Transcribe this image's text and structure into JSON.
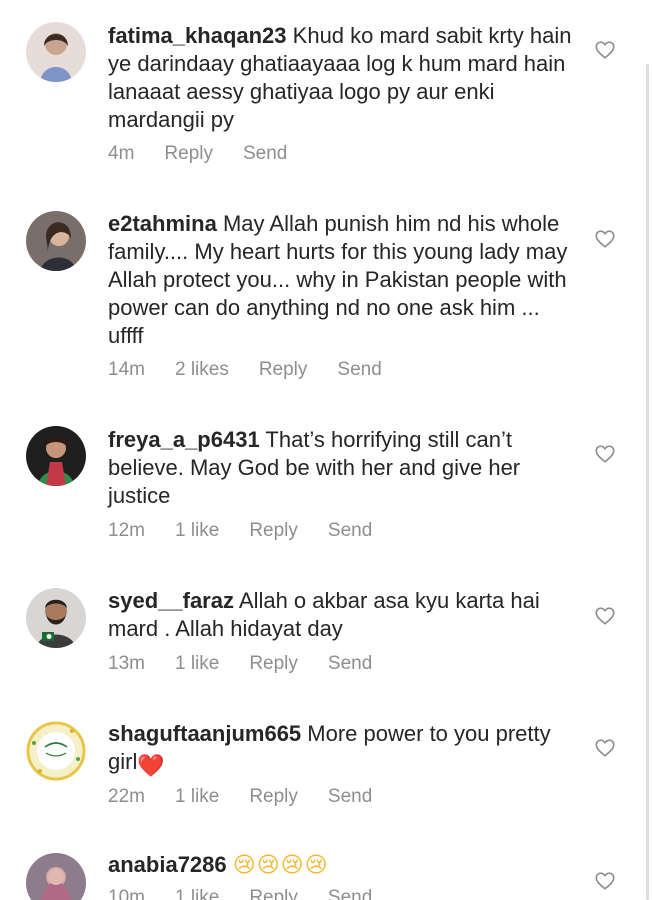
{
  "comments": [
    {
      "username": "fatima_khaqan23",
      "text": "Khud ko mard sabit krty hain ye darindaay ghatiaayaaa log k hum mard hain lanaaat aessy ghatiyaa logo py aur enki mardangii py",
      "time": "4m",
      "likes": "",
      "reply": "Reply",
      "send": "Send"
    },
    {
      "username": "e2tahmina",
      "text": "May Allah punish him nd his whole family.... My heart hurts for this young lady may Allah protect you... why in Pakistan people with power can do anything nd no one ask him ... uffff",
      "time": "14m",
      "likes": "2 likes",
      "reply": "Reply",
      "send": "Send"
    },
    {
      "username": "freya_a_p6431",
      "text": "That’s horrifying still can’t believe. May God be with her and give her justice",
      "time": "12m",
      "likes": "1 like",
      "reply": "Reply",
      "send": "Send"
    },
    {
      "username": "syed__faraz",
      "text": "Allah o akbar asa kyu karta hai mard . Allah hidayat day",
      "time": "13m",
      "likes": "1 like",
      "reply": "Reply",
      "send": "Send"
    },
    {
      "username": "shaguftaanjum665",
      "text": "More power to you pretty girl",
      "emoji": "❤️",
      "time": "22m",
      "likes": "1 like",
      "reply": "Reply",
      "send": "Send"
    },
    {
      "username": "anabia7286",
      "text": "",
      "emoji": "😢😢😢😢",
      "time": "10m",
      "likes": "1 like",
      "reply": "Reply",
      "send": "Send"
    }
  ],
  "icons": {
    "like": "heart-outline-icon"
  },
  "colors": {
    "text": "#262626",
    "meta": "#8e8e8e",
    "heart_emoji": "#e0245e"
  }
}
